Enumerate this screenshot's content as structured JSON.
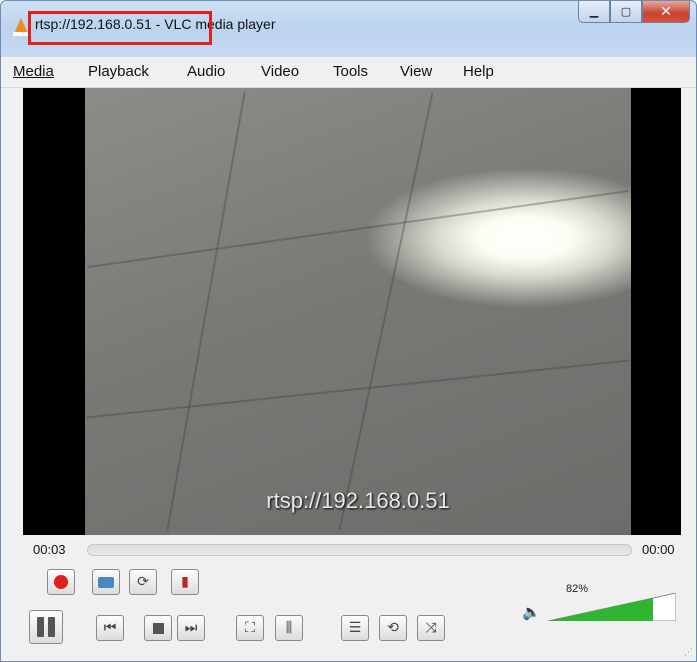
{
  "window": {
    "title_url": "rtsp://192.168.0.51",
    "title_suffix": " - VLC media player"
  },
  "menu": [
    "Media",
    "Playback",
    "Audio",
    "Video",
    "Tools",
    "View",
    "Help"
  ],
  "video": {
    "overlay_text": "rtsp://192.168.0.51"
  },
  "seek": {
    "elapsed": "00:03",
    "total": "00:00",
    "position": 0
  },
  "volume": {
    "percent_label": "82%",
    "level": 0.82
  },
  "colors": {
    "highlight": "#e0201c",
    "volume_fill": "#2fb52f"
  },
  "icons": {
    "record": "record-icon",
    "snapshot": "camera-icon",
    "loop_ab": "ab-loop-icon",
    "frame_step": "frame-by-frame-icon",
    "pause": "pause-icon",
    "previous": "previous-icon",
    "stop": "stop-icon",
    "next": "next-icon",
    "fullscreen": "fullscreen-icon",
    "extended": "equalizer-icon",
    "playlist": "playlist-icon",
    "loop": "loop-icon",
    "shuffle": "shuffle-icon",
    "speaker": "speaker-icon"
  }
}
